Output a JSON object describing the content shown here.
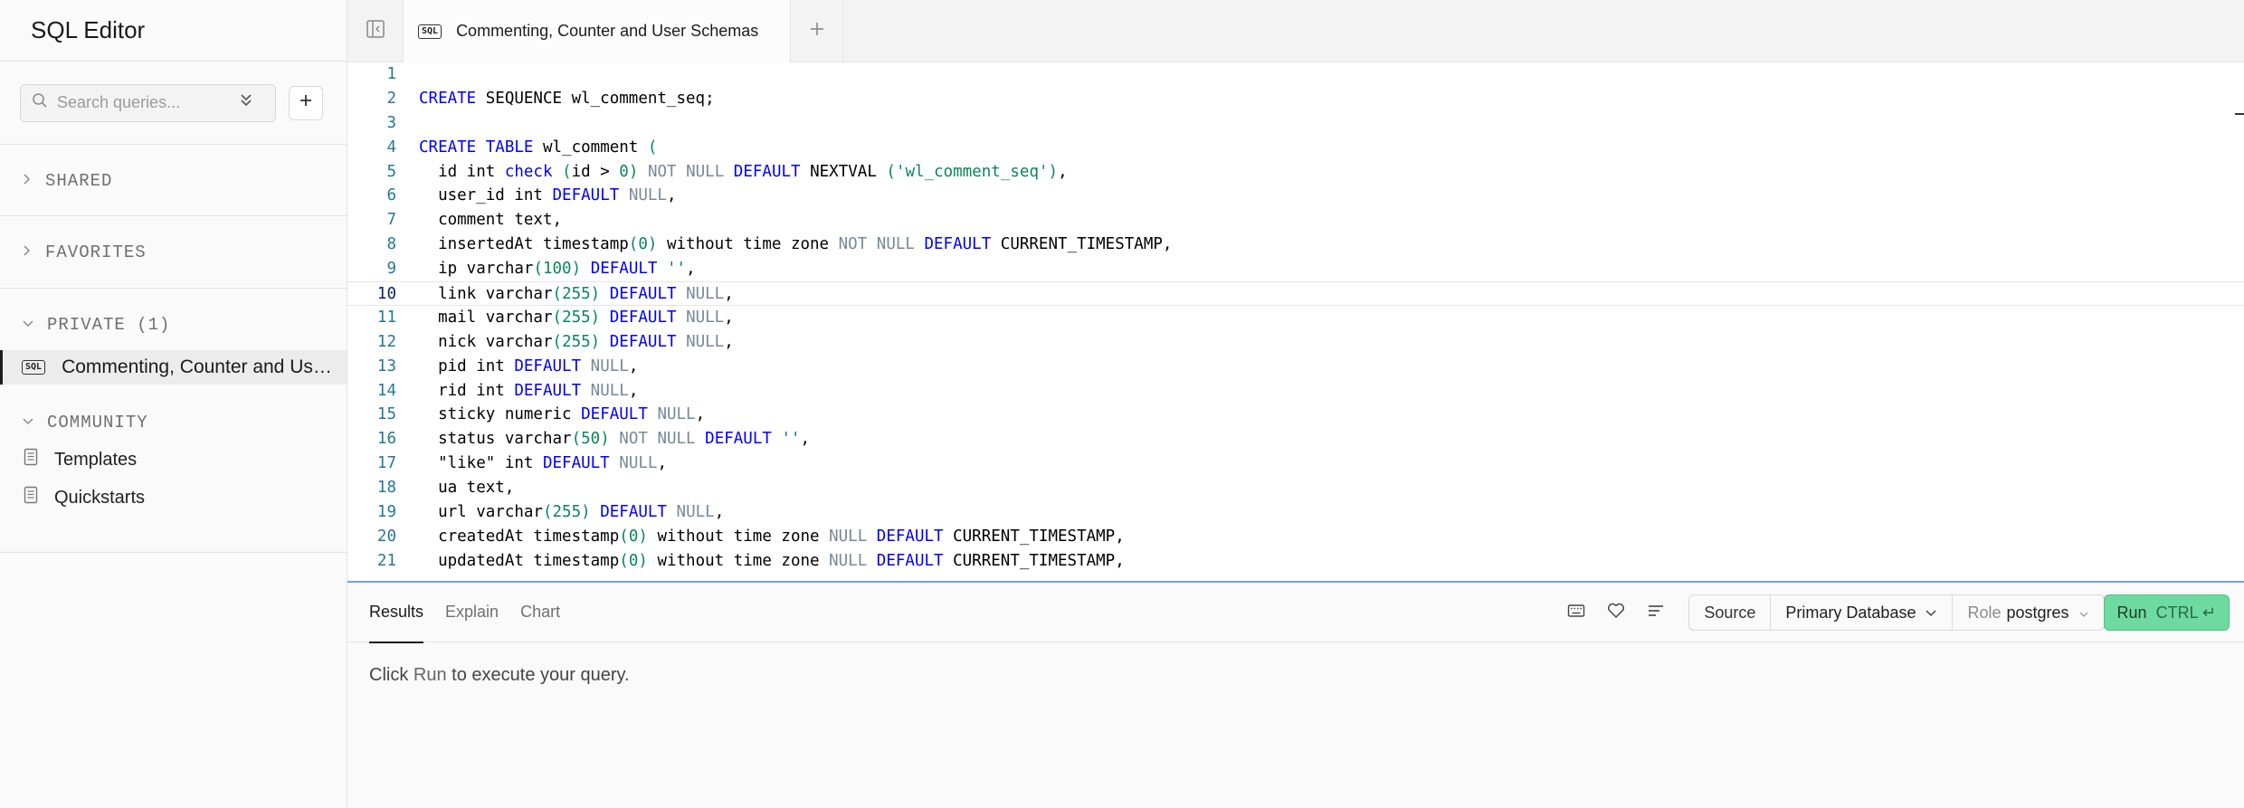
{
  "sidebar": {
    "title": "SQL Editor",
    "search_placeholder": "Search queries...",
    "sections": {
      "shared": "SHARED",
      "favorites": "FAVORITES",
      "private": "PRIVATE (1)",
      "community": "COMMUNITY"
    },
    "private_items": [
      {
        "badge": "SQL",
        "label": "Commenting, Counter and User Schemas"
      }
    ],
    "community_items": [
      {
        "label": "Templates",
        "icon": "document-icon"
      },
      {
        "label": "Quickstarts",
        "icon": "document-icon"
      }
    ]
  },
  "tabs": [
    {
      "badge": "SQL",
      "label": "Commenting, Counter and User Schemas"
    }
  ],
  "editor": {
    "active_line": 10,
    "lines": [
      "",
      "CREATE SEQUENCE wl_comment_seq;",
      "",
      "CREATE TABLE wl_comment (",
      "  id int check (id > 0) NOT NULL DEFAULT NEXTVAL ('wl_comment_seq'),",
      "  user_id int DEFAULT NULL,",
      "  comment text,",
      "  insertedAt timestamp(0) without time zone NOT NULL DEFAULT CURRENT_TIMESTAMP,",
      "  ip varchar(100) DEFAULT '',",
      "  link varchar(255) DEFAULT NULL,",
      "  mail varchar(255) DEFAULT NULL,",
      "  nick varchar(255) DEFAULT NULL,",
      "  pid int DEFAULT NULL,",
      "  rid int DEFAULT NULL,",
      "  sticky numeric DEFAULT NULL,",
      "  status varchar(50) NOT NULL DEFAULT '',",
      "  \"like\" int DEFAULT NULL,",
      "  ua text,",
      "  url varchar(255) DEFAULT NULL,",
      "  createdAt timestamp(0) without time zone NULL DEFAULT CURRENT_TIMESTAMP,",
      "  updatedAt timestamp(0) without time zone NULL DEFAULT CURRENT_TIMESTAMP,"
    ]
  },
  "results": {
    "tabs": [
      "Results",
      "Explain",
      "Chart"
    ],
    "active_tab": "Results",
    "source_label": "Source",
    "database": "Primary Database",
    "role_label": "Role",
    "role_value": "postgres",
    "run_label": "Run",
    "run_shortcut": "CTRL ↵",
    "message_prefix": "Click",
    "message_run": "Run",
    "message_suffix": "to execute your query."
  },
  "colors": {
    "run_button": "#6fda9f",
    "keyword": "#0000ff",
    "number": "#098658",
    "line_number": "#237893"
  }
}
